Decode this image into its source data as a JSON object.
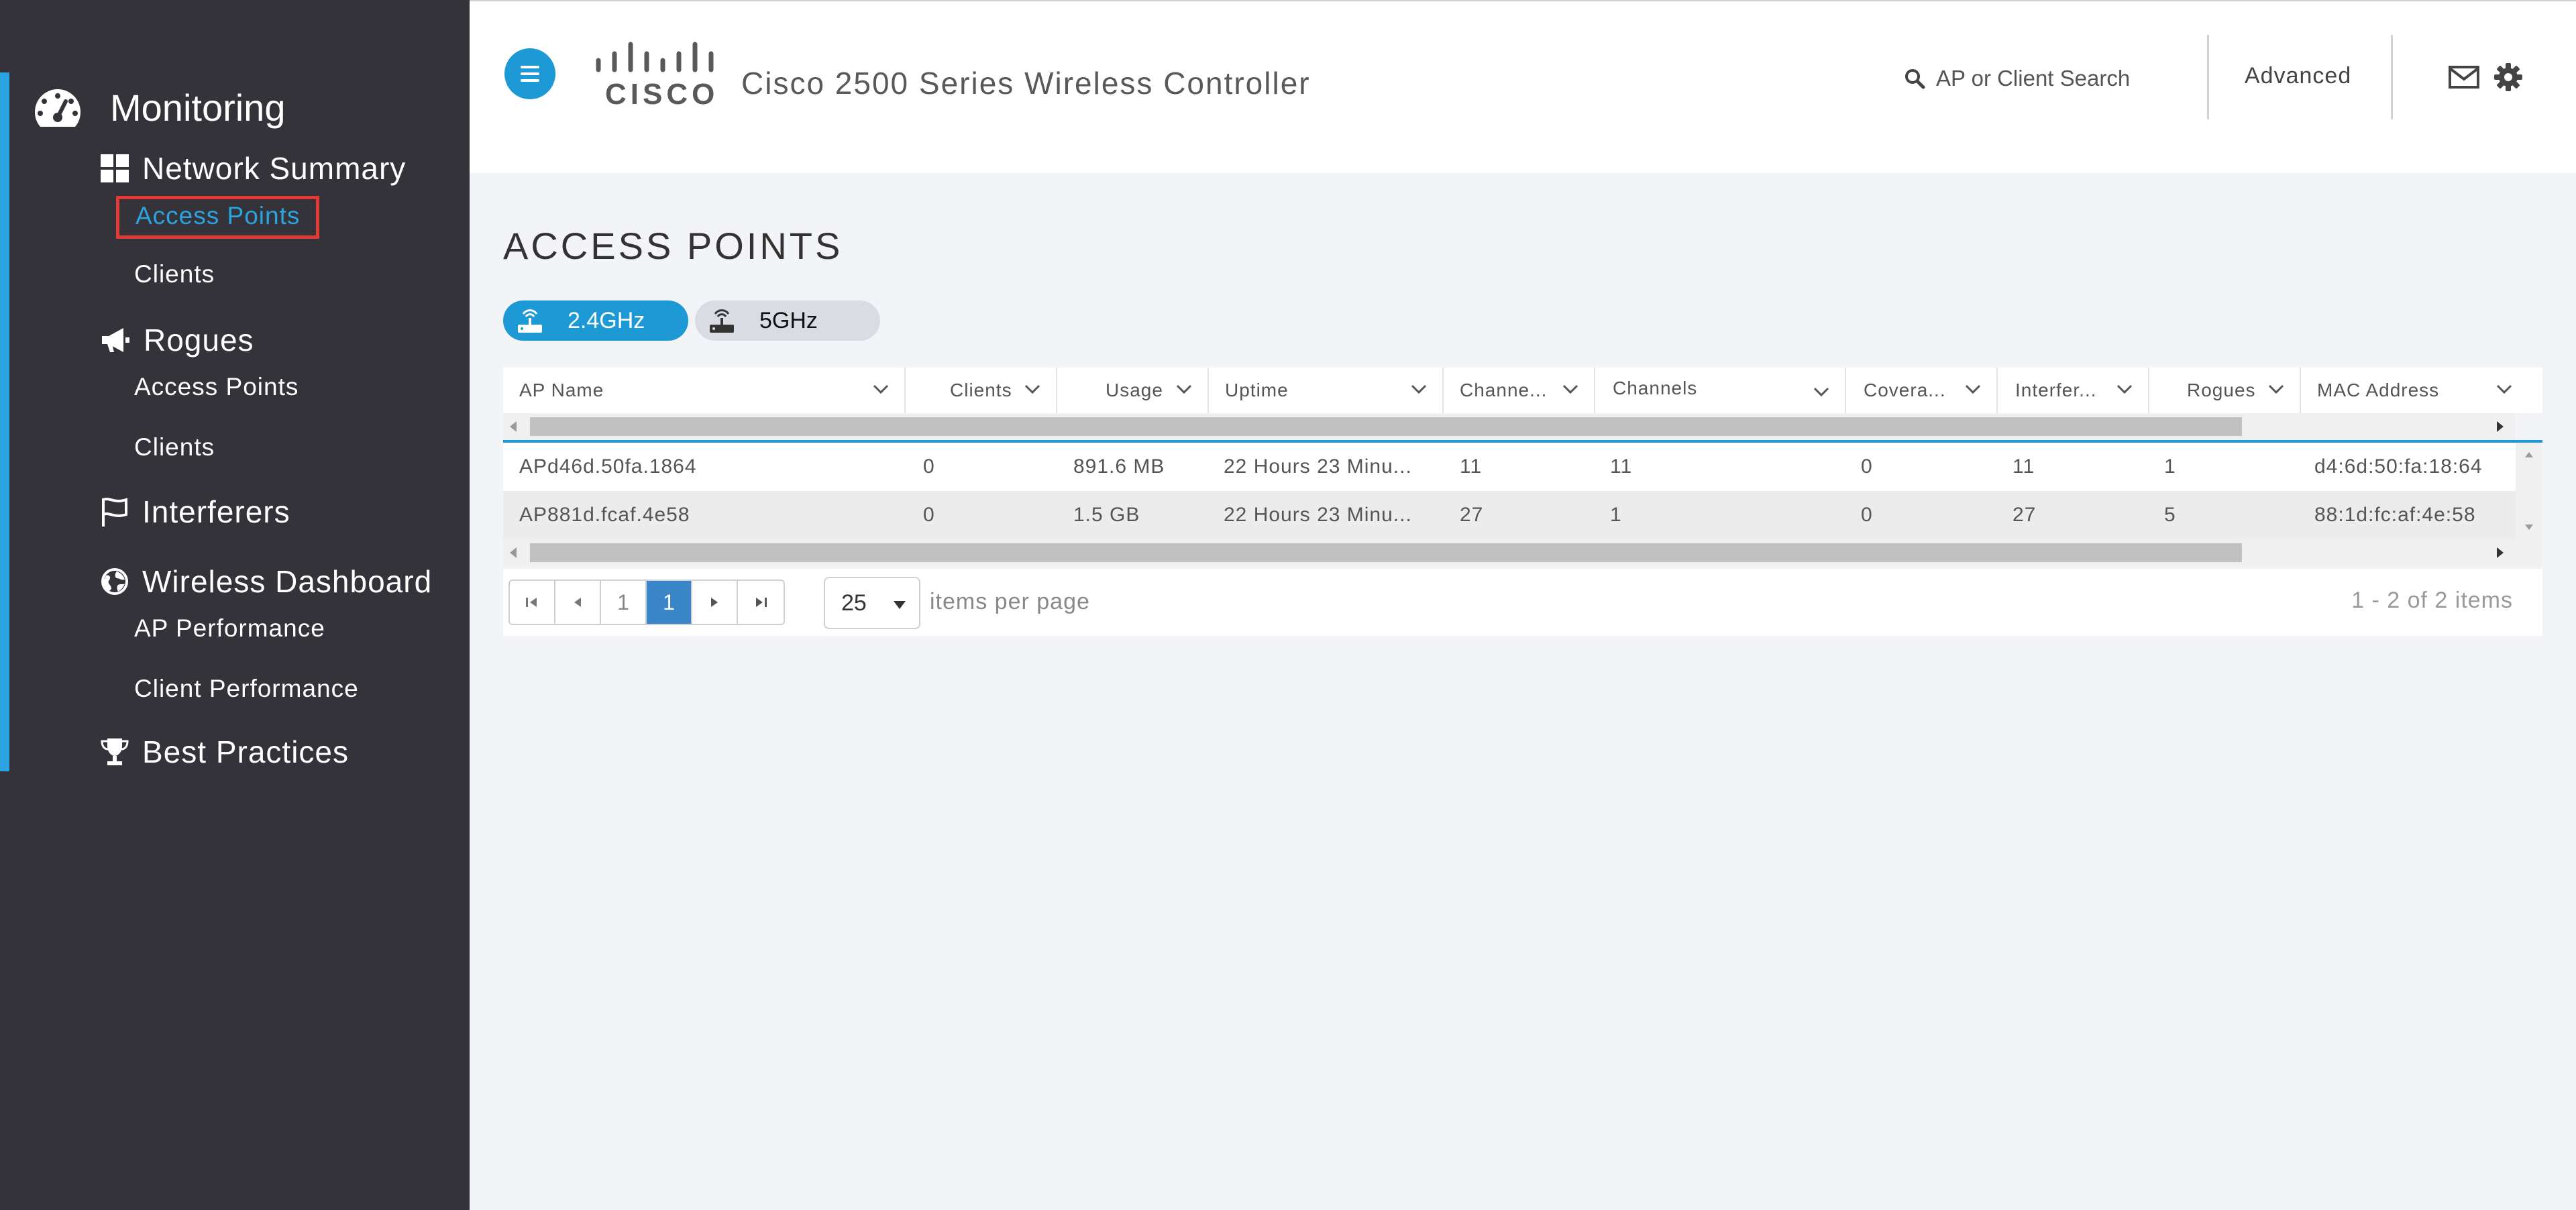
{
  "sidebar": {
    "main_label": "Monitoring",
    "network_summary": {
      "label": "Network Summary",
      "items": [
        "Access Points",
        "Clients"
      ]
    },
    "rogues": {
      "label": "Rogues",
      "items": [
        "Access Points",
        "Clients"
      ]
    },
    "interferers": {
      "label": "Interferers"
    },
    "wireless_dashboard": {
      "label": "Wireless Dashboard",
      "items": [
        "AP Performance",
        "Client Performance"
      ]
    },
    "best_practices": {
      "label": "Best Practices"
    },
    "active_item": "Network Summary > Access Points",
    "accent_color": "#2aa3e0",
    "highlight_color": "#e23b36"
  },
  "header": {
    "brand_text": "CISCO",
    "title": "Cisco 2500 Series Wireless Controller",
    "search_placeholder": "AP or Client Search",
    "advanced_label": "Advanced",
    "icons": [
      "menu-icon",
      "search-icon",
      "mail-icon",
      "gear-icon"
    ]
  },
  "main": {
    "title": "ACCESS POINTS",
    "bands": [
      {
        "label": "2.4GHz",
        "selected": true
      },
      {
        "label": "5GHz",
        "selected": false
      }
    ],
    "columns": [
      "AP Name",
      "Clients",
      "Usage",
      "Uptime",
      "Channe...",
      "Channels",
      "Covera...",
      "Interfer...",
      "Rogues",
      "MAC Address"
    ],
    "rows": [
      [
        "APd46d.50fa.1864",
        "0",
        "891.6 MB",
        "22 Hours 23 Minu...",
        "11",
        "11",
        "0",
        "11",
        "1",
        "d4:6d:50:fa:18:64"
      ],
      [
        "AP881d.fcaf.4e58",
        "0",
        "1.5 GB",
        "22 Hours 23 Minu...",
        "27",
        "1",
        "0",
        "27",
        "5",
        "88:1d:fc:af:4e:58"
      ]
    ],
    "pager": {
      "prev_page": "1",
      "current_page": "1",
      "page_size": "25",
      "page_size_label": "items per page",
      "summary": "1 - 2 of 2 items"
    },
    "accent_color": "#1d9ad6"
  }
}
